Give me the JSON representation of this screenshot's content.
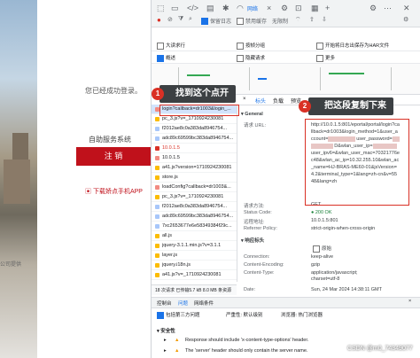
{
  "left_page": {
    "notice": "您已经成功登录。",
    "service": "自助服务系统",
    "logout": "注 销",
    "download": "下载娇点手机APP",
    "footer_text": "公司提供"
  },
  "toolbar": {
    "network_tab": "网络",
    "preserve_log": "保留日志",
    "disable_cache": "禁用缓存",
    "throttle": "无限制"
  },
  "filter": {
    "row1_a": "大读求行",
    "row1_b": "按帧分组",
    "row1_c": "开始将日志出保存为HAR文件",
    "row2_a": "概述",
    "row2_b": "隐藏请求",
    "row2_c": "更多"
  },
  "requests": [
    {
      "name": "login?callback=dr1003&login_..."
    },
    {
      "name": "pc_3.js?v=_1710924230081"
    },
    {
      "name": "f2012ae8c0a383da8946754..."
    },
    {
      "name": "adc89c69599bc383da8946754..."
    },
    {
      "name": "10.0.1.5"
    },
    {
      "name": "10.0.1.5"
    },
    {
      "name": "a41.js?version=1710924230081"
    },
    {
      "name": "store.js"
    },
    {
      "name": "loadConfig?callback=dr1003&..."
    },
    {
      "name": "pc_3.js?v=_1710924230081"
    },
    {
      "name": "f2012ae8c0a383da8946754..."
    },
    {
      "name": "adc89c69599bc383da8946754..."
    },
    {
      "name": "7xc2653677e6e58349384f29c..."
    },
    {
      "name": "all.js"
    },
    {
      "name": "jquery-3.1.1.min.js?v=3.1.1"
    },
    {
      "name": "layer.js"
    },
    {
      "name": "jquery.i18n.js"
    },
    {
      "name": "a41.js?v=_1710924230081"
    }
  ],
  "detail_tabs": {
    "headers": "标头",
    "preview": "负载",
    "response": "预览"
  },
  "general": {
    "section": "▾ General",
    "url_label": "请求 URL:",
    "url_value": "http://10.0.1.5:801/eportal/portal/login?callback=dr1003&login_method=1&user_account=",
    "url_line2": "user_password=",
    "url_line3": "D&wlan_user_ip=",
    "url_line4": "user_ipv6=&wlan_user_mac=70321776ec48&wlan_ac_ip=10.32.255.10&wlan_ac_name=HJ-BRAS-ME60-01&jsVersion=4.2&terminal_type=1&lang=zh-cn&v=5548&lang=zh",
    "method_label": "请求方法:",
    "method_value": "GET",
    "status_label": "Status Code:",
    "status_value": "● 200 OK",
    "remote_label": "远程地址:",
    "remote_value": "10.0.1.5:801",
    "referrer_label": "Referrer Policy:",
    "referrer_value": "strict-origin-when-cross-origin"
  },
  "response_headers": {
    "section": "▾ 响应标头",
    "raw": "原始",
    "conn_label": "Connection:",
    "conn_value": "keep-alive",
    "enc_label": "Content-Encoding:",
    "enc_value": "gzip",
    "type_label": "Content-Type:",
    "type_value": "application/javascript; charset=utf-8",
    "date_label": "Date:",
    "date_value": "Sun, 24 Mar 2024 14:38:11 GMT"
  },
  "status_bar": {
    "text": "18 次请求  已传输5.7 kB  8.0 MB 条资源"
  },
  "console": {
    "tab1": "控制台",
    "tab2": "问题",
    "tab3": "网络条件",
    "filter1": "包括第三方问题",
    "filter2": "严重性: 默认级别",
    "filter3": "浏览器: 热门浏览器",
    "section": "▾ 安全性",
    "line1": "Response should include 'x-content-type-options' header.",
    "line2": "The 'server' header should only contain the server name."
  },
  "callouts": {
    "c1_num": "1",
    "c1_text": "找到这个点开",
    "c2_num": "2",
    "c2_text": "把这段复制下来"
  },
  "watermark": "CSDN @m0_74349077"
}
